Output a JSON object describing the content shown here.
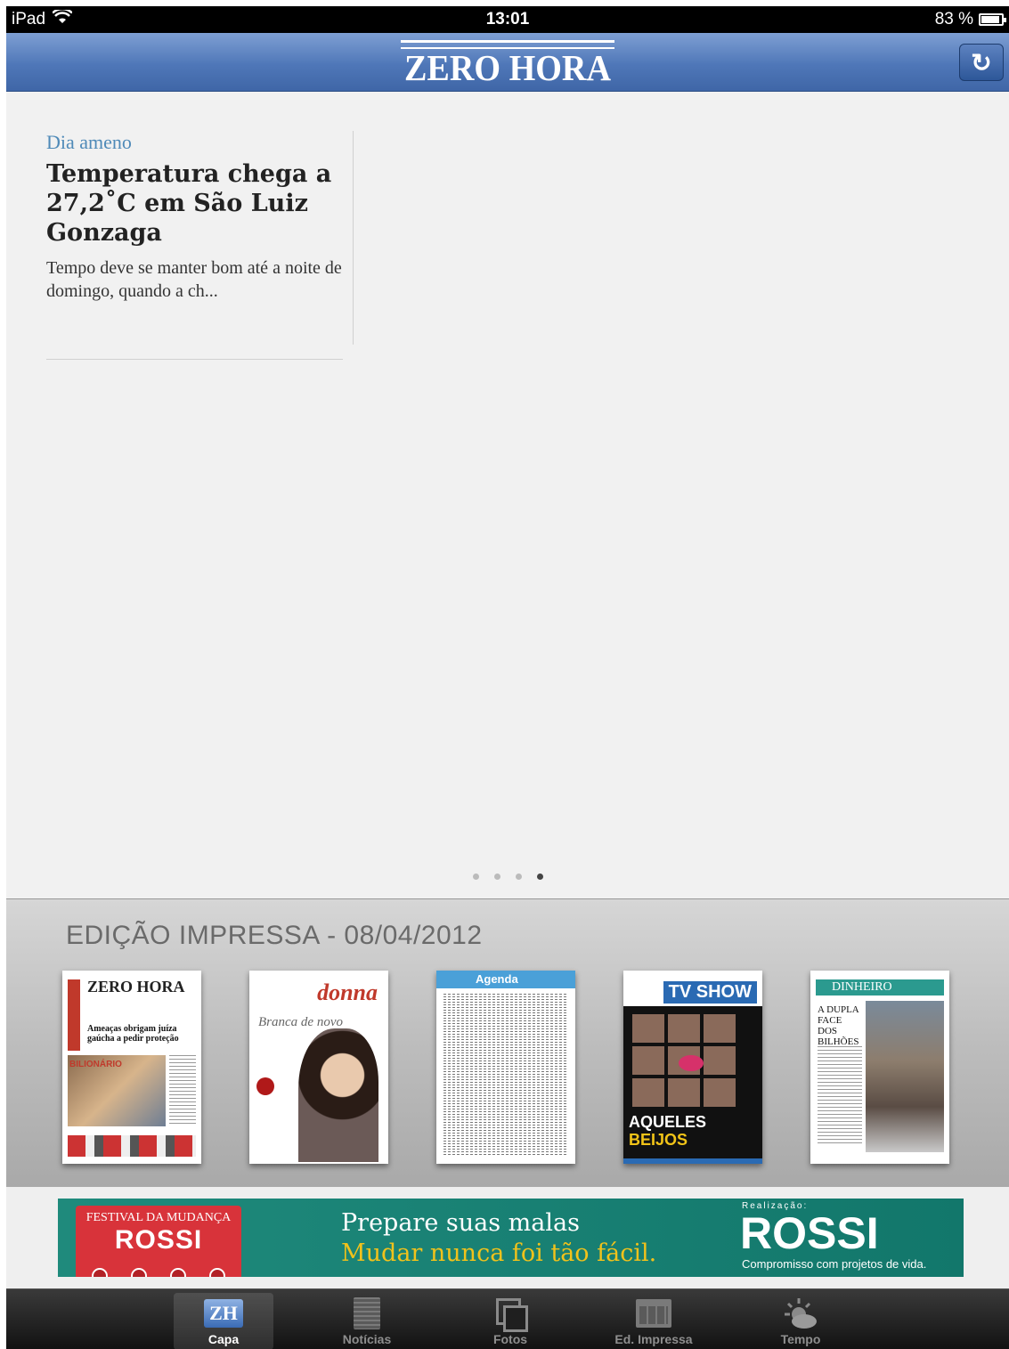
{
  "status_bar": {
    "device": "iPad",
    "time": "13:01",
    "battery": "83 %",
    "battery_level": 0.83
  },
  "nav": {
    "logo": "ZERO HORA",
    "refresh_icon": "refresh-icon"
  },
  "article": {
    "kicker": "Dia ameno",
    "headline": "Temperatura chega a 27,2˚C em São Luiz Gonzaga",
    "summary": "Tempo deve se manter bom até a noite de domingo, quando a ch..."
  },
  "pager": {
    "count": 4,
    "active_index": 3
  },
  "print_edition": {
    "title": "EDIÇÃO IMPRESSA - 08/04/2012",
    "covers": [
      {
        "masthead": "ZERO HORA",
        "side": "DOMINGO",
        "headline": "Ameaças obrigam juíza gaúcha a pedir proteção",
        "tag": "BILIONÁRIO"
      },
      {
        "masthead": "donna",
        "headline": "Branca de novo"
      },
      {
        "masthead": "Agenda"
      },
      {
        "masthead": "TV SHOW",
        "headline_1": "AQUELES",
        "headline_2": "BEIJOS"
      },
      {
        "masthead": "DINHEIRO",
        "headline": "A DUPLA FACE DOS BILHÕES"
      }
    ]
  },
  "banner": {
    "festival": "FESTIVAL DA MUDANÇA",
    "brand_small": "ROSSI",
    "line1": "Prepare suas malas",
    "line2": "Mudar nunca foi tão fácil.",
    "realizacao": "Realização:",
    "brand_big": "ROSSI",
    "tagline": "Compromisso com projetos de vida."
  },
  "tabbar": {
    "tabs": [
      {
        "label": "Capa",
        "icon": "zh-icon",
        "active": true
      },
      {
        "label": "Notícias",
        "icon": "document-icon",
        "active": false
      },
      {
        "label": "Fotos",
        "icon": "photos-icon",
        "active": false
      },
      {
        "label": "Ed. Impressa",
        "icon": "newspaper-icon",
        "active": false
      },
      {
        "label": "Tempo",
        "icon": "weather-icon",
        "active": false
      }
    ]
  },
  "colors": {
    "nav_blue": "#4f77b8",
    "kicker_blue": "#4f8ab8",
    "banner_green": "#1f8a7c",
    "banner_yellow": "#f1c21b"
  }
}
